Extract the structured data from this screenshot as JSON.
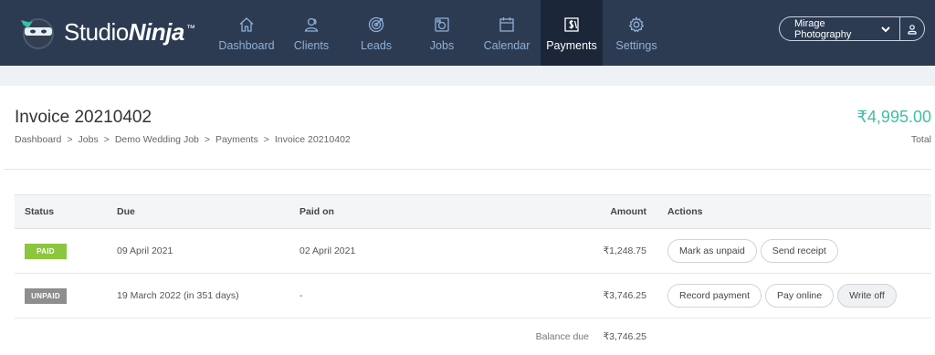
{
  "app": {
    "logo_text_plain": "Studio",
    "logo_text_bold": "Ninja",
    "logo_tm": "™"
  },
  "nav": {
    "items": [
      {
        "label": "Dashboard",
        "icon": "home-icon"
      },
      {
        "label": "Clients",
        "icon": "clients-icon"
      },
      {
        "label": "Leads",
        "icon": "target-icon"
      },
      {
        "label": "Jobs",
        "icon": "camera-icon"
      },
      {
        "label": "Calendar",
        "icon": "calendar-icon"
      },
      {
        "label": "Payments",
        "icon": "payments-icon",
        "active": true
      },
      {
        "label": "Settings",
        "icon": "gear-icon"
      }
    ]
  },
  "account": {
    "name": "Mirage Photography"
  },
  "page": {
    "title": "Invoice 20210402",
    "breadcrumb": [
      "Dashboard",
      ">",
      "Jobs",
      ">",
      "Demo Wedding Job",
      ">",
      "Payments",
      ">",
      "Invoice 20210402"
    ],
    "total_amount": "₹4,995.00",
    "total_label": "Total"
  },
  "table": {
    "headers": {
      "status": "Status",
      "due": "Due",
      "paid_on": "Paid on",
      "amount": "Amount",
      "actions": "Actions"
    },
    "rows": [
      {
        "status": "PAID",
        "due": "09 April 2021",
        "paid_on": "02 April 2021",
        "amount": "₹1,248.75",
        "actions": [
          "Mark as unpaid",
          "Send receipt"
        ]
      },
      {
        "status": "UNPAID",
        "due": "19 March 2022 (in 351 days)",
        "paid_on": "-",
        "amount": "₹3,746.25",
        "actions": [
          "Record payment",
          "Pay online",
          "Write off"
        ]
      }
    ],
    "balance_label": "Balance due",
    "balance_value": "₹3,746.25"
  },
  "colors": {
    "nav_bg": "#2c3b52",
    "nav_active_bg": "#1b2738",
    "nav_text": "#8fb0d6",
    "total_accent": "#3dbfa3",
    "paid_badge": "#8cc63f",
    "unpaid_badge": "#8e8e8e"
  }
}
